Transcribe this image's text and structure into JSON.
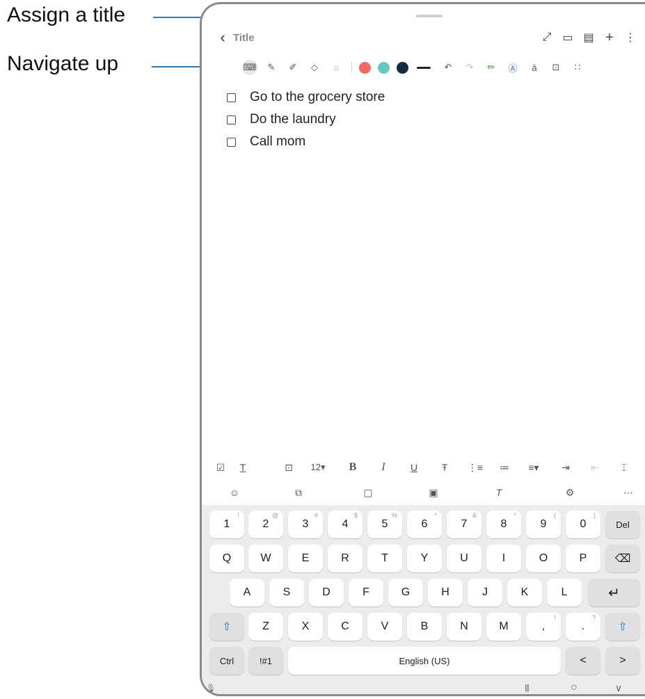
{
  "callouts": {
    "assign_title": "Assign a title",
    "navigate_up": "Navigate up"
  },
  "colors": {
    "callout_line": "#2b7bb9",
    "swatch_red": "#f06b62",
    "swatch_teal": "#69c8bd",
    "swatch_navy": "#152c45"
  },
  "app": {
    "title_placeholder": "Title",
    "back_icon": "back-chevron-icon",
    "top_actions": [
      "expand-icon",
      "book-view-icon",
      "page-settings-icon",
      "add-icon",
      "more-options-icon"
    ]
  },
  "pen_toolbar": {
    "tools": [
      "keyboard-icon",
      "pen-icon",
      "highlighter-icon",
      "eraser-icon",
      "lasso-icon"
    ],
    "selected_tool": "keyboard-icon",
    "colors": [
      "red",
      "teal",
      "navy"
    ],
    "extra_tools": [
      "undo-icon",
      "redo-icon",
      "pencil-icon",
      "text-style-icon",
      "text-convert-icon",
      "lock-icon",
      "more-tools-icon"
    ]
  },
  "checklist": {
    "items": [
      "Go to the grocery store",
      "Do the laundry",
      "Call mom"
    ]
  },
  "format_bar": {
    "font_size": "12▾",
    "bold": "B",
    "italic": "I",
    "underline": "U",
    "strikethrough": "Ŧ"
  },
  "keyboard": {
    "row_numbers": [
      {
        "main": "1",
        "sup": "!"
      },
      {
        "main": "2",
        "sup": "@"
      },
      {
        "main": "3",
        "sup": "#"
      },
      {
        "main": "4",
        "sup": "$"
      },
      {
        "main": "5",
        "sup": "%"
      },
      {
        "main": "6",
        "sup": "^"
      },
      {
        "main": "7",
        "sup": "&"
      },
      {
        "main": "8",
        "sup": "*"
      },
      {
        "main": "9",
        "sup": "("
      },
      {
        "main": "0",
        "sup": ")"
      }
    ],
    "del": "Del",
    "row_q": [
      "Q",
      "W",
      "E",
      "R",
      "T",
      "Y",
      "U",
      "I",
      "O",
      "P"
    ],
    "row_a": [
      "A",
      "S",
      "D",
      "F",
      "G",
      "H",
      "J",
      "K",
      "L"
    ],
    "row_z": [
      "Z",
      "X",
      "C",
      "V",
      "B",
      "N",
      "M"
    ],
    "comma": {
      "main": ",",
      "sup": "!"
    },
    "period": {
      "main": ".",
      "sup": "?"
    },
    "ctrl": "Ctrl",
    "symbols": "!#1",
    "space": "English (US)",
    "left": "<",
    "right": ">"
  },
  "navbar": {
    "recent": "|||",
    "home": "○",
    "back": "∨"
  }
}
